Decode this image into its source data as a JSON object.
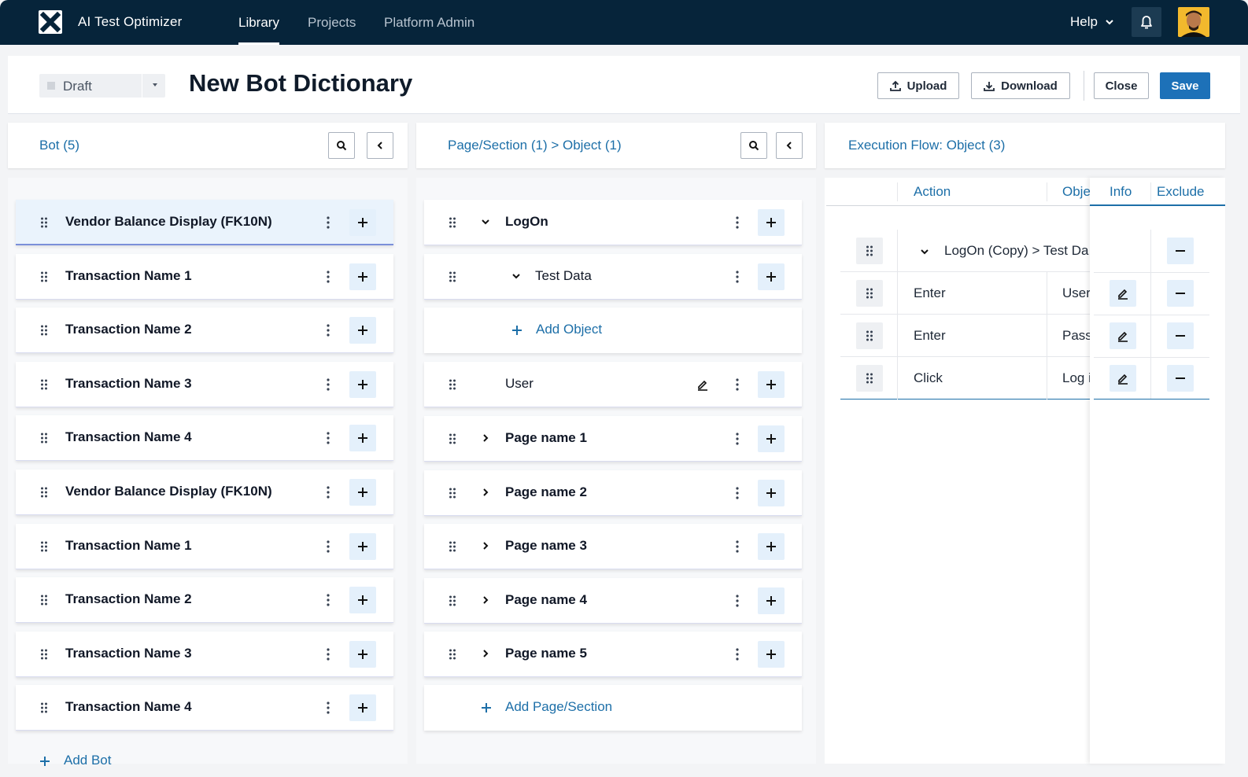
{
  "nav": {
    "app_name": "AI Test Optimizer",
    "tabs": [
      {
        "label": "Library",
        "active": true
      },
      {
        "label": "Projects",
        "active": false
      },
      {
        "label": "Platform Admin",
        "active": false
      }
    ],
    "help_label": "Help"
  },
  "header": {
    "status": "Draft",
    "title": "New Bot Dictionary",
    "upload_label": "Upload",
    "download_label": "Download",
    "close_label": "Close",
    "save_label": "Save"
  },
  "bot_panel": {
    "title": "Bot (5)",
    "items": [
      "Vendor Balance Display (FK10N)",
      "Transaction Name 1",
      "Transaction Name 2",
      "Transaction Name 3",
      "Transaction Name 4",
      "Vendor Balance Display (FK10N)",
      "Transaction Name 1",
      "Transaction Name 2",
      "Transaction Name 3",
      "Transaction Name 4"
    ],
    "add_label": "Add Bot"
  },
  "page_panel": {
    "title": "Page/Section (1) > Object (1)",
    "logon_label": "LogOn",
    "test_data_label": "Test Data",
    "add_object_label": "Add Object",
    "user_label": "User",
    "pages": [
      "Page name 1",
      "Page name 2",
      "Page name 3",
      "Page name 4",
      "Page name 5"
    ],
    "add_page_label": "Add Page/Section"
  },
  "flow_panel": {
    "title": "Execution Flow: Object (3)",
    "columns": {
      "action": "Action",
      "object": "Obje",
      "info": "Info",
      "exclude": "Exclude"
    },
    "group_label": "LogOn (Copy) > Test Da",
    "rows": [
      {
        "action": "Enter",
        "object": "User"
      },
      {
        "action": "Enter",
        "object": "Pass"
      },
      {
        "action": "Click",
        "object": "Log i"
      }
    ]
  },
  "colors": {
    "nav_bg": "#06243a",
    "accent": "#1d71b8",
    "link": "#1d6fa8",
    "plus_bg": "#e4f0fb"
  }
}
